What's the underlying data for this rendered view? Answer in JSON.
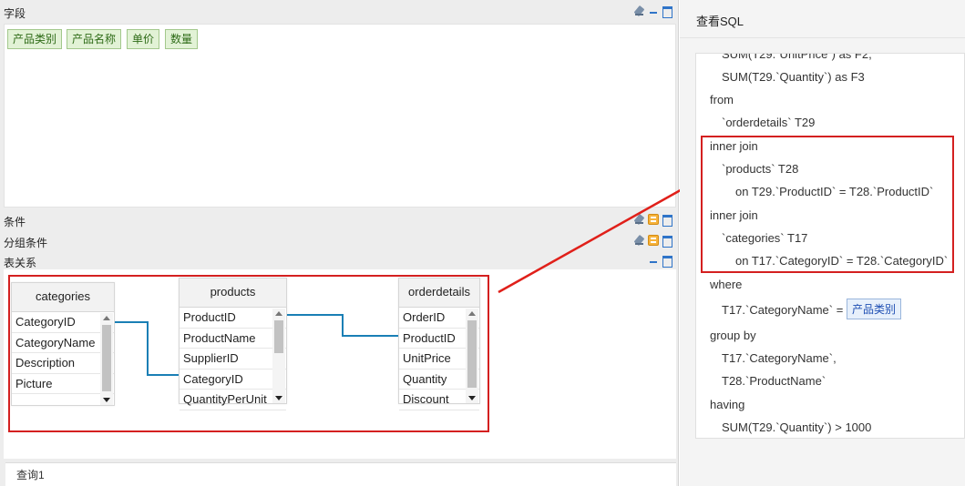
{
  "fields_section": {
    "title": "字段",
    "chips": [
      "产品类别",
      "产品名称",
      "单价",
      "数量"
    ]
  },
  "conditions_section": {
    "title": "条件"
  },
  "group_conditions_section": {
    "title": "分组条件"
  },
  "relations_section": {
    "title": "表关系",
    "tables": [
      {
        "name": "categories",
        "fields": [
          "CategoryID",
          "CategoryName",
          "Description",
          "Picture"
        ]
      },
      {
        "name": "products",
        "fields": [
          "ProductID",
          "ProductName",
          "SupplierID",
          "CategoryID",
          "QuantityPerUnit"
        ]
      },
      {
        "name": "orderdetails",
        "fields": [
          "OrderID",
          "ProductID",
          "UnitPrice",
          "Quantity",
          "Discount"
        ]
      }
    ]
  },
  "bottom_tab": {
    "label": "查询1"
  },
  "sql_panel": {
    "title": "查看SQL",
    "lines": [
      "SUM(T29.`UnitPrice`) as F2,",
      "SUM(T29.`Quantity`) as F3",
      "from",
      "`orderdetails` T29",
      "inner join",
      "`products` T28",
      "on T29.`ProductID` = T28.`ProductID`",
      "inner join",
      "`categories` T17",
      "on T17.`CategoryID` = T28.`CategoryID`",
      "where",
      "T17.`CategoryName` =",
      "group by",
      "T17.`CategoryName`,",
      "T28.`ProductName`",
      "having",
      "SUM(T29.`Quantity`) > 1000"
    ],
    "param_chip": "产品类别"
  },
  "colors": {
    "highlight_red": "#d42020",
    "link_line": "#1a7fb5",
    "chip_green_bg": "#e2f2d6"
  }
}
